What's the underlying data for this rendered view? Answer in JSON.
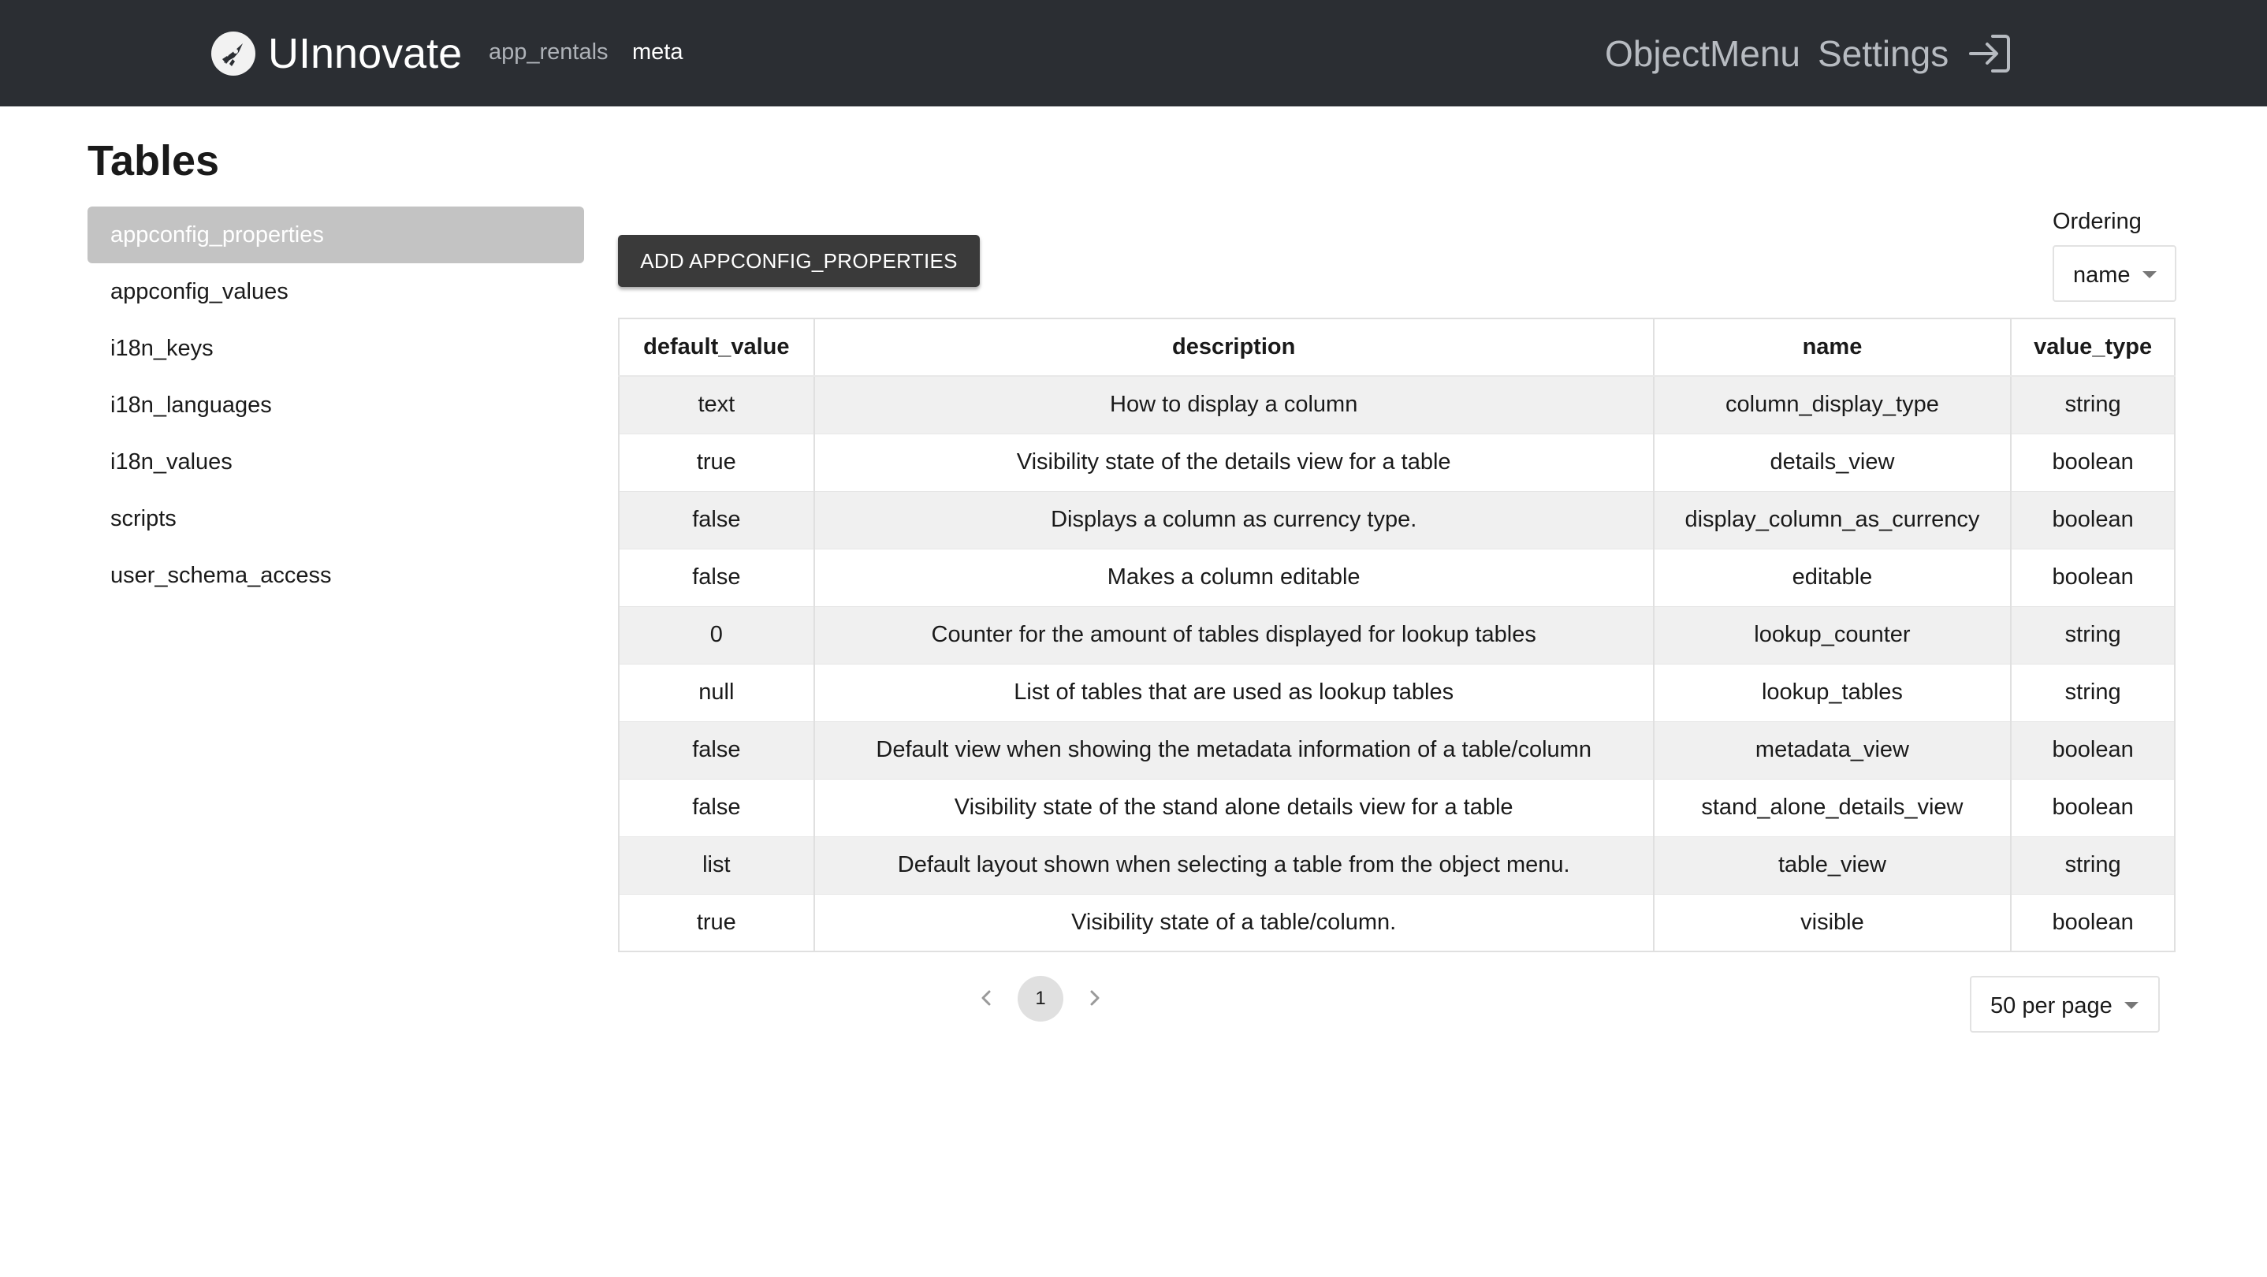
{
  "header": {
    "brand": "UInnovate",
    "nav": [
      "app_rentals",
      "meta"
    ],
    "right": [
      "ObjectMenu",
      "Settings"
    ],
    "logo_icon": "rocket-logo-icon",
    "logout_icon": "logout-icon"
  },
  "page": {
    "title": "Tables"
  },
  "sidebar": {
    "items": [
      {
        "label": "appconfig_properties",
        "active": true
      },
      {
        "label": "appconfig_values"
      },
      {
        "label": "i18n_keys"
      },
      {
        "label": "i18n_languages"
      },
      {
        "label": "i18n_values"
      },
      {
        "label": "scripts"
      },
      {
        "label": "user_schema_access"
      }
    ]
  },
  "toolbar": {
    "add_label": "ADD APPCONFIG_PROPERTIES",
    "ordering_label": "Ordering",
    "ordering_value": "name"
  },
  "table": {
    "columns": [
      "default_value",
      "description",
      "name",
      "value_type"
    ],
    "rows": [
      [
        "text",
        "How to display a column",
        "column_display_type",
        "string"
      ],
      [
        "true",
        "Visibility state of the details view for a table",
        "details_view",
        "boolean"
      ],
      [
        "false",
        "Displays a column as currency type.",
        "display_column_as_currency",
        "boolean"
      ],
      [
        "false",
        "Makes a column editable",
        "editable",
        "boolean"
      ],
      [
        "0",
        "Counter for the amount of tables displayed for lookup tables",
        "lookup_counter",
        "string"
      ],
      [
        "null",
        "List of tables that are used as lookup tables",
        "lookup_tables",
        "string"
      ],
      [
        "false",
        "Default view when showing the metadata information of a table/column",
        "metadata_view",
        "boolean"
      ],
      [
        "false",
        "Visibility state of the stand alone details view for a table",
        "stand_alone_details_view",
        "boolean"
      ],
      [
        "list",
        "Default layout shown when selecting a table from the object menu.",
        "table_view",
        "string"
      ],
      [
        "true",
        "Visibility state of a table/column.",
        "visible",
        "boolean"
      ]
    ]
  },
  "pagination": {
    "current_page": "1",
    "per_page": "50 per page"
  },
  "colors": {
    "topbar": "#2b2e33",
    "active_item": "#c3c3c3",
    "button": "#3a3a3a",
    "row_stripe": "#f0f0f0"
  }
}
